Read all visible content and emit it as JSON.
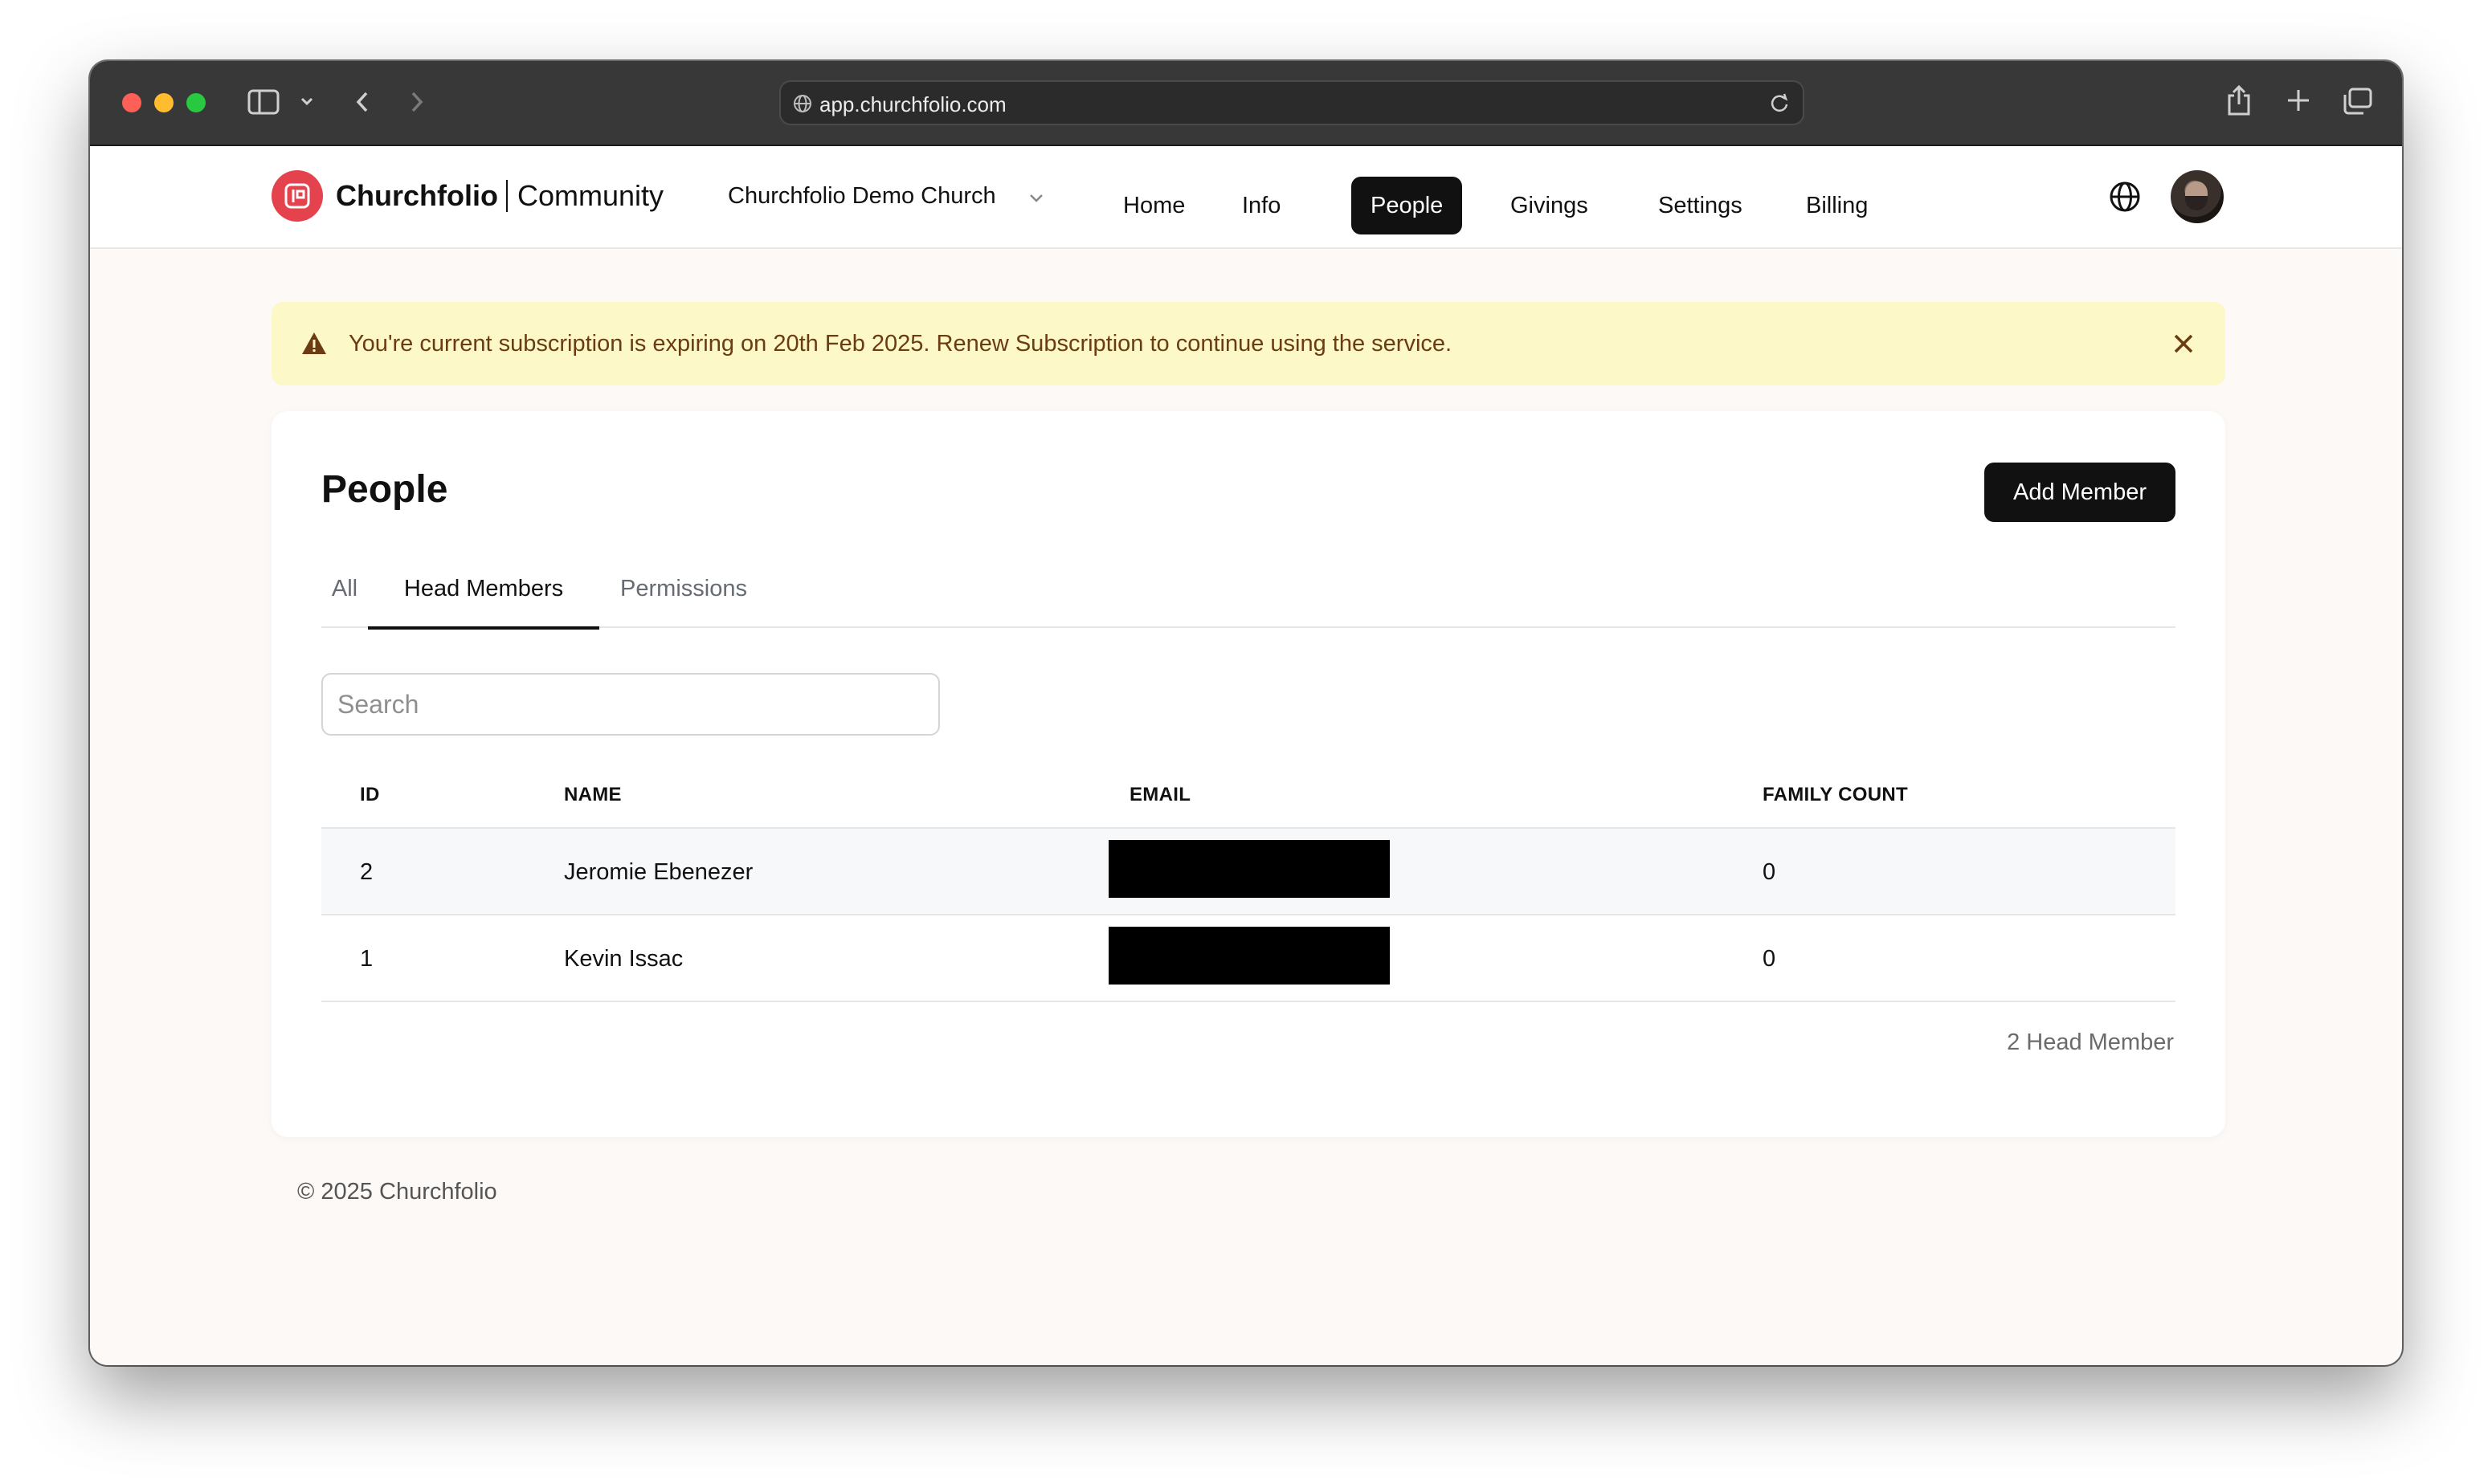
{
  "browser": {
    "url": "app.churchfolio.com"
  },
  "brand": {
    "name": "Churchfolio",
    "product": "Community",
    "accent": "#e4424d"
  },
  "header": {
    "church": "Churchfolio Demo Church",
    "nav": [
      "Home",
      "Info",
      "People",
      "Givings",
      "Settings",
      "Billing"
    ],
    "active_nav": "People"
  },
  "alert": {
    "message": "You're current subscription is expiring on 20th Feb 2025. Renew Subscription to continue using the service."
  },
  "page": {
    "title": "People",
    "add_button": "Add Member",
    "tabs": [
      "All",
      "Head Members",
      "Permissions"
    ],
    "active_tab": "Head Members",
    "search_placeholder": "Search",
    "columns": [
      "ID",
      "NAME",
      "EMAIL",
      "FAMILY COUNT"
    ],
    "rows": [
      {
        "id": "2",
        "name": "Jeromie Ebenezer",
        "email": "[redacted]",
        "family_count": "0"
      },
      {
        "id": "1",
        "name": "Kevin Issac",
        "email": "[redacted]",
        "family_count": "0"
      }
    ],
    "summary": "2 Head Member"
  },
  "footer": {
    "copyright": "© 2025 Churchfolio"
  }
}
